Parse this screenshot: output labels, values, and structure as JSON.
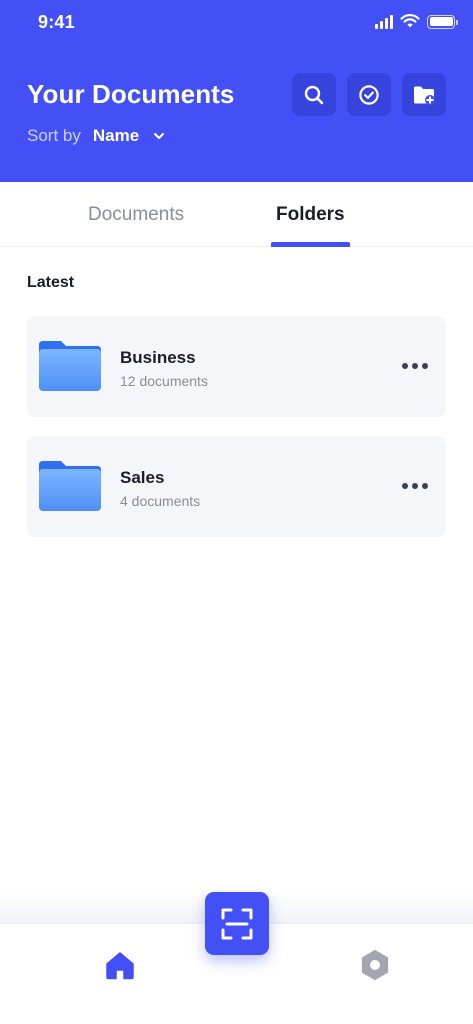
{
  "status_bar": {
    "time": "9:41",
    "icons": [
      "signal-icon",
      "wifi-icon",
      "battery-icon"
    ]
  },
  "header": {
    "title": "Your Documents",
    "sort_label": "Sort by",
    "sort_value": "Name",
    "actions": [
      "search-icon",
      "check-circle-icon",
      "folder-add-icon"
    ]
  },
  "tabs": [
    {
      "label": "Documents",
      "active": false
    },
    {
      "label": "Folders",
      "active": true
    }
  ],
  "section": {
    "title": "Latest"
  },
  "folders": [
    {
      "name": "Business",
      "count": "12 documents"
    },
    {
      "name": "Sales",
      "count": "4 documents"
    }
  ],
  "bottom_nav": {
    "items": [
      "home-icon",
      "scan-icon",
      "settings-icon"
    ],
    "active": "home-icon"
  },
  "colors": {
    "accent": "#4350f5",
    "text_primary": "#1b1d2a",
    "text_secondary": "#8a8e9b",
    "card_background": "#f4f6fa",
    "folder_light": "#6aa8ff",
    "folder_dark": "#2f6ff0",
    "inactive_icon": "#a3a6b0"
  }
}
